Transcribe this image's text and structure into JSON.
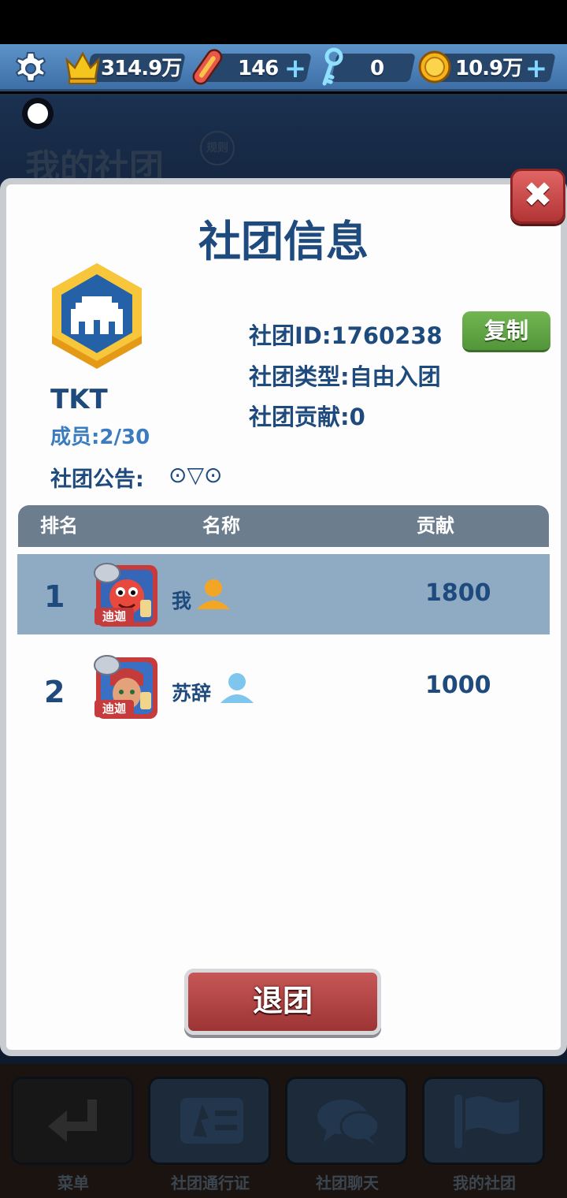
{
  "topbar": {
    "crowns": "314.9万",
    "boards": "146",
    "keys": "0",
    "coins": "10.9万",
    "plus": "+"
  },
  "background": {
    "title": "我的社团",
    "rules": "规则"
  },
  "modal": {
    "title": "社团信息",
    "club_name": "TKT",
    "members": "成员:2/30",
    "club_id": "社团ID:1760238",
    "copy_label": "复制",
    "club_type": "社团类型:自由入团",
    "contribution": "社团贡献:0",
    "notice_label": "社团公告:",
    "notice_value": "⊙▽⊙",
    "close_glyph": "✖",
    "quit_label": "退团"
  },
  "table": {
    "headers": {
      "rank": "排名",
      "name": "名称",
      "contribution": "贡献"
    },
    "rows": [
      {
        "rank": "1",
        "name": "我",
        "contribution": "1800",
        "badge_text": "迪迦"
      },
      {
        "rank": "2",
        "name": "苏辞",
        "contribution": "1000",
        "badge_text": "迪迦"
      }
    ]
  },
  "nav": {
    "items": [
      {
        "label": "菜单",
        "icon": "return-icon"
      },
      {
        "label": "社团通行证",
        "icon": "pass-icon"
      },
      {
        "label": "社团聊天",
        "icon": "chat-icon"
      },
      {
        "label": "我的社团",
        "icon": "flag-icon"
      }
    ]
  },
  "colors": {
    "title_blue": "#1e4a7d",
    "highlight_row": "#8fabc4",
    "copy_green": "#5fa544",
    "quit_red": "#b04444"
  }
}
